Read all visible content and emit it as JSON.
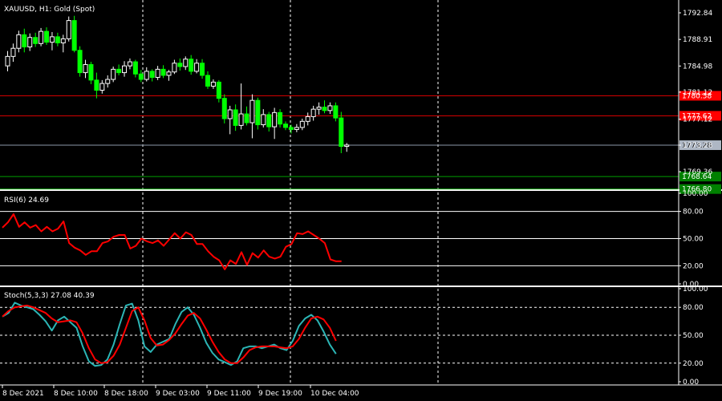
{
  "chart_data": [
    {
      "type": "candlestick",
      "title": "XAUUSD, H1:  Gold (Spot)",
      "ylim": [
        1767.0,
        1794.5
      ],
      "yticks": [
        "1792.84",
        "1788.91",
        "1784.98",
        "1781.12",
        "1777.12",
        "1773.28",
        "1769.36"
      ],
      "hlines": [
        {
          "label": "1780.58",
          "value": 1780.58,
          "color": "#e00000",
          "tagbg": "#ff0000"
        },
        {
          "label": "1777.62",
          "value": 1777.62,
          "color": "#e00000",
          "tagbg": "#ff0000"
        },
        {
          "label": "1773.28",
          "value": 1773.28,
          "color": "#8b97a8",
          "tagbg": "#aeb7c4",
          "tagtext": "#000000"
        },
        {
          "label": "1768.64",
          "value": 1768.64,
          "color": "#00a000",
          "tagbg": "#008000"
        },
        {
          "label": "1766.80",
          "value": 1766.8,
          "color": "#00a000",
          "tagbg": "#008000"
        }
      ],
      "up_color": "#ffffff",
      "down_color": "#00ff00",
      "candles": [
        [
          1785.0,
          1787.2,
          1784.2,
          1786.4
        ],
        [
          1786.4,
          1788.3,
          1785.6,
          1787.6
        ],
        [
          1787.6,
          1790.2,
          1787.0,
          1789.6
        ],
        [
          1789.6,
          1790.5,
          1787.0,
          1787.8
        ],
        [
          1787.8,
          1789.8,
          1787.2,
          1789.2
        ],
        [
          1789.2,
          1789.9,
          1787.8,
          1788.3
        ],
        [
          1788.3,
          1790.6,
          1787.9,
          1790.1
        ],
        [
          1790.1,
          1790.7,
          1788.1,
          1788.5
        ],
        [
          1788.5,
          1790.0,
          1787.3,
          1789.3
        ],
        [
          1789.3,
          1789.9,
          1787.9,
          1788.4
        ],
        [
          1788.4,
          1789.6,
          1787.0,
          1789.0
        ],
        [
          1789.0,
          1792.3,
          1788.6,
          1791.7
        ],
        [
          1791.7,
          1792.4,
          1787.0,
          1787.3
        ],
        [
          1787.3,
          1787.9,
          1783.4,
          1784.0
        ],
        [
          1784.0,
          1785.9,
          1783.2,
          1785.2
        ],
        [
          1785.2,
          1785.6,
          1782.3,
          1782.9
        ],
        [
          1782.9,
          1784.0,
          1780.2,
          1781.4
        ],
        [
          1781.4,
          1782.9,
          1780.9,
          1782.4
        ],
        [
          1782.4,
          1783.6,
          1781.8,
          1783.0
        ],
        [
          1783.0,
          1784.9,
          1782.6,
          1784.5
        ],
        [
          1784.5,
          1785.2,
          1783.6,
          1784.0
        ],
        [
          1784.0,
          1785.7,
          1783.4,
          1785.0
        ],
        [
          1785.0,
          1786.1,
          1784.5,
          1785.6
        ],
        [
          1785.6,
          1785.9,
          1783.3,
          1783.8
        ],
        [
          1783.8,
          1784.4,
          1782.6,
          1783.0
        ],
        [
          1783.0,
          1784.8,
          1782.7,
          1784.2
        ],
        [
          1784.2,
          1784.5,
          1782.7,
          1783.3
        ],
        [
          1783.3,
          1785.0,
          1782.9,
          1784.5
        ],
        [
          1784.5,
          1785.1,
          1783.2,
          1783.6
        ],
        [
          1783.6,
          1784.4,
          1782.8,
          1784.1
        ],
        [
          1784.1,
          1785.9,
          1783.8,
          1785.4
        ],
        [
          1785.4,
          1786.1,
          1784.3,
          1784.9
        ],
        [
          1784.9,
          1786.4,
          1784.4,
          1786.0
        ],
        [
          1786.0,
          1786.6,
          1783.7,
          1784.2
        ],
        [
          1784.2,
          1786.0,
          1783.9,
          1785.4
        ],
        [
          1785.4,
          1786.0,
          1783.1,
          1783.6
        ],
        [
          1783.6,
          1784.2,
          1781.6,
          1782.0
        ],
        [
          1782.0,
          1783.0,
          1781.6,
          1782.6
        ],
        [
          1782.6,
          1782.9,
          1779.6,
          1780.2
        ],
        [
          1780.2,
          1780.8,
          1776.5,
          1777.2
        ],
        [
          1777.2,
          1779.1,
          1774.9,
          1778.5
        ],
        [
          1778.5,
          1779.3,
          1775.4,
          1776.2
        ],
        [
          1776.2,
          1782.4,
          1775.6,
          1777.9
        ],
        [
          1777.9,
          1779.0,
          1776.2,
          1776.6
        ],
        [
          1776.6,
          1780.8,
          1774.3,
          1779.9
        ],
        [
          1779.9,
          1780.3,
          1775.6,
          1776.3
        ],
        [
          1776.3,
          1778.6,
          1775.9,
          1777.8
        ],
        [
          1777.8,
          1778.2,
          1775.3,
          1776.0
        ],
        [
          1776.0,
          1778.8,
          1774.2,
          1778.1
        ],
        [
          1778.1,
          1778.6,
          1775.9,
          1776.4
        ],
        [
          1776.4,
          1776.8,
          1775.5,
          1775.9
        ],
        [
          1775.9,
          1776.3,
          1775.0,
          1775.6
        ],
        [
          1775.6,
          1776.4,
          1775.2,
          1775.9
        ],
        [
          1775.9,
          1777.2,
          1775.5,
          1776.8
        ],
        [
          1776.8,
          1778.1,
          1776.2,
          1777.5
        ],
        [
          1777.5,
          1779.1,
          1776.9,
          1778.6
        ],
        [
          1778.6,
          1779.6,
          1777.8,
          1778.9
        ],
        [
          1778.9,
          1779.9,
          1778.0,
          1778.4
        ],
        [
          1778.4,
          1779.6,
          1777.9,
          1779.1
        ],
        [
          1779.1,
          1779.6,
          1776.8,
          1777.3
        ],
        [
          1777.3,
          1778.2,
          1772.1,
          1773.1
        ],
        [
          1773.1,
          1773.6,
          1772.3,
          1773.3
        ]
      ]
    },
    {
      "type": "line",
      "title": "RSI(6) 24.69",
      "ylim": [
        0,
        100
      ],
      "yticks": [
        "100.00",
        "80.00",
        "50.00",
        "20.00",
        "0.00"
      ],
      "levels": [
        80,
        50,
        20
      ],
      "series": [
        {
          "color": "#ff0000",
          "values": [
            62,
            68,
            77,
            63,
            68,
            62,
            65,
            58,
            63,
            58,
            61,
            69,
            45,
            40,
            37,
            32,
            36,
            36,
            45,
            47,
            52,
            54,
            54,
            39,
            42,
            50,
            47,
            45,
            48,
            42,
            49,
            56,
            50,
            57,
            54,
            44,
            44,
            36,
            30,
            26,
            16,
            26,
            22,
            35,
            21,
            34,
            29,
            37,
            30,
            28,
            30,
            41,
            44,
            56,
            55,
            58,
            54,
            50,
            45,
            27,
            25,
            25
          ]
        }
      ]
    },
    {
      "type": "line",
      "title": "Stoch(5,3,3) 27.08 40.39",
      "ylim": [
        0,
        100
      ],
      "yticks": [
        "100.00",
        "80.00",
        "50.00",
        "20.00",
        "0.00"
      ],
      "levels": [
        80,
        50,
        20
      ],
      "series": [
        {
          "color": "#2cb5b5",
          "values": [
            70,
            74,
            85,
            82,
            80,
            78,
            72,
            65,
            55,
            66,
            70,
            64,
            58,
            38,
            22,
            17,
            18,
            24,
            40,
            62,
            82,
            84,
            66,
            38,
            32,
            40,
            43,
            46,
            62,
            75,
            80,
            72,
            58,
            42,
            31,
            24,
            21,
            18,
            22,
            36,
            38,
            38,
            36,
            38,
            40,
            36,
            34,
            44,
            60,
            68,
            72,
            66,
            54,
            40,
            30
          ]
        },
        {
          "color": "#ff0000",
          "values": [
            70,
            76,
            80,
            81,
            82,
            80,
            77,
            74,
            68,
            64,
            65,
            66,
            64,
            52,
            36,
            24,
            20,
            21,
            28,
            40,
            58,
            76,
            80,
            66,
            47,
            39,
            40,
            45,
            52,
            62,
            71,
            74,
            68,
            56,
            43,
            32,
            24,
            20,
            20,
            26,
            34,
            37,
            38,
            38,
            38,
            37,
            36,
            38,
            46,
            58,
            68,
            70,
            67,
            58,
            44
          ]
        }
      ]
    }
  ],
  "xaxis": {
    "labels": [
      "8 Dec 2021",
      "8 Dec 10:00",
      "8 Dec 18:00",
      "9 Dec 03:00",
      "9 Dec 11:00",
      "9 Dec 19:00",
      "10 Dec 04:00"
    ]
  }
}
